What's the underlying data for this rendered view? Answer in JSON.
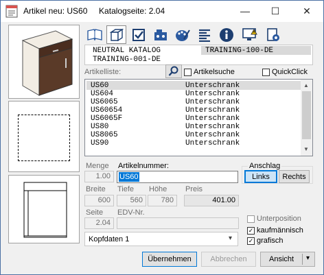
{
  "window": {
    "title": "Artikel neu: US60     Katalogseite: 2.04",
    "minimize_glyph": "—",
    "maximize_glyph": "☐",
    "close_glyph": "✕"
  },
  "toolbar": {
    "tabs": [
      {
        "name": "book-icon"
      },
      {
        "name": "cube-icon"
      },
      {
        "name": "checkbox-icon"
      },
      {
        "name": "machine-icon"
      },
      {
        "name": "palette-icon"
      },
      {
        "name": "text-align-icon"
      },
      {
        "name": "info-icon"
      },
      {
        "name": "monitor-warning-icon"
      },
      {
        "name": "settings-doc-icon"
      }
    ]
  },
  "catalog": {
    "line1_left": "NEUTRAL KATALOG",
    "line1_right": "TRAINING-100-DE",
    "line2_left": "TRAINING-001-DE"
  },
  "list": {
    "label": "Artikelliste:",
    "search_label": "Artikelsuche",
    "quickclick_label": "QuickClick",
    "items": [
      {
        "code": "US60",
        "type": "Unterschrank"
      },
      {
        "code": "US604",
        "type": "Unterschrank"
      },
      {
        "code": "US6065",
        "type": "Unterschrank"
      },
      {
        "code": "US60654",
        "type": "Unterschrank"
      },
      {
        "code": "US6065F",
        "type": "Unterschrank"
      },
      {
        "code": "US80",
        "type": "Unterschrank"
      },
      {
        "code": "US8065",
        "type": "Unterschrank"
      },
      {
        "code": "US90",
        "type": "Unterschrank"
      }
    ]
  },
  "form": {
    "menge_label": "Menge",
    "menge_value": "1.00",
    "artikelnummer_label": "Artikelnummer:",
    "artikelnummer_value": "US60",
    "anschlag_label": "Anschlag",
    "links_label": "Links",
    "rechts_label": "Rechts",
    "breite_label": "Breite",
    "breite_value": "600",
    "tiefe_label": "Tiefe",
    "tiefe_value": "560",
    "hoehe_label": "Höhe",
    "hoehe_value": "780",
    "preis_label": "Preis",
    "preis_value": "401.00",
    "seite_label": "Seite",
    "seite_value": "2.04",
    "edv_label": "EDV-Nr.",
    "edv_value": "",
    "unterposition_label": "Unterposition",
    "kaufmaennisch_label": "kaufmännisch",
    "grafisch_label": "grafisch",
    "kopfdaten_value": "Kopfdaten 1",
    "check_glyph": "✓"
  },
  "buttons": {
    "uebernehmen": "Übernehmen",
    "abbrechen": "Abbrechen",
    "ansicht": "Ansicht",
    "dropdown_glyph": "▾"
  },
  "colors": {
    "selection": "#dcdcdc",
    "highlight": "#0078d7",
    "cabinet_wood": "#5a3a28",
    "cabinet_front": "#f2ede4"
  }
}
